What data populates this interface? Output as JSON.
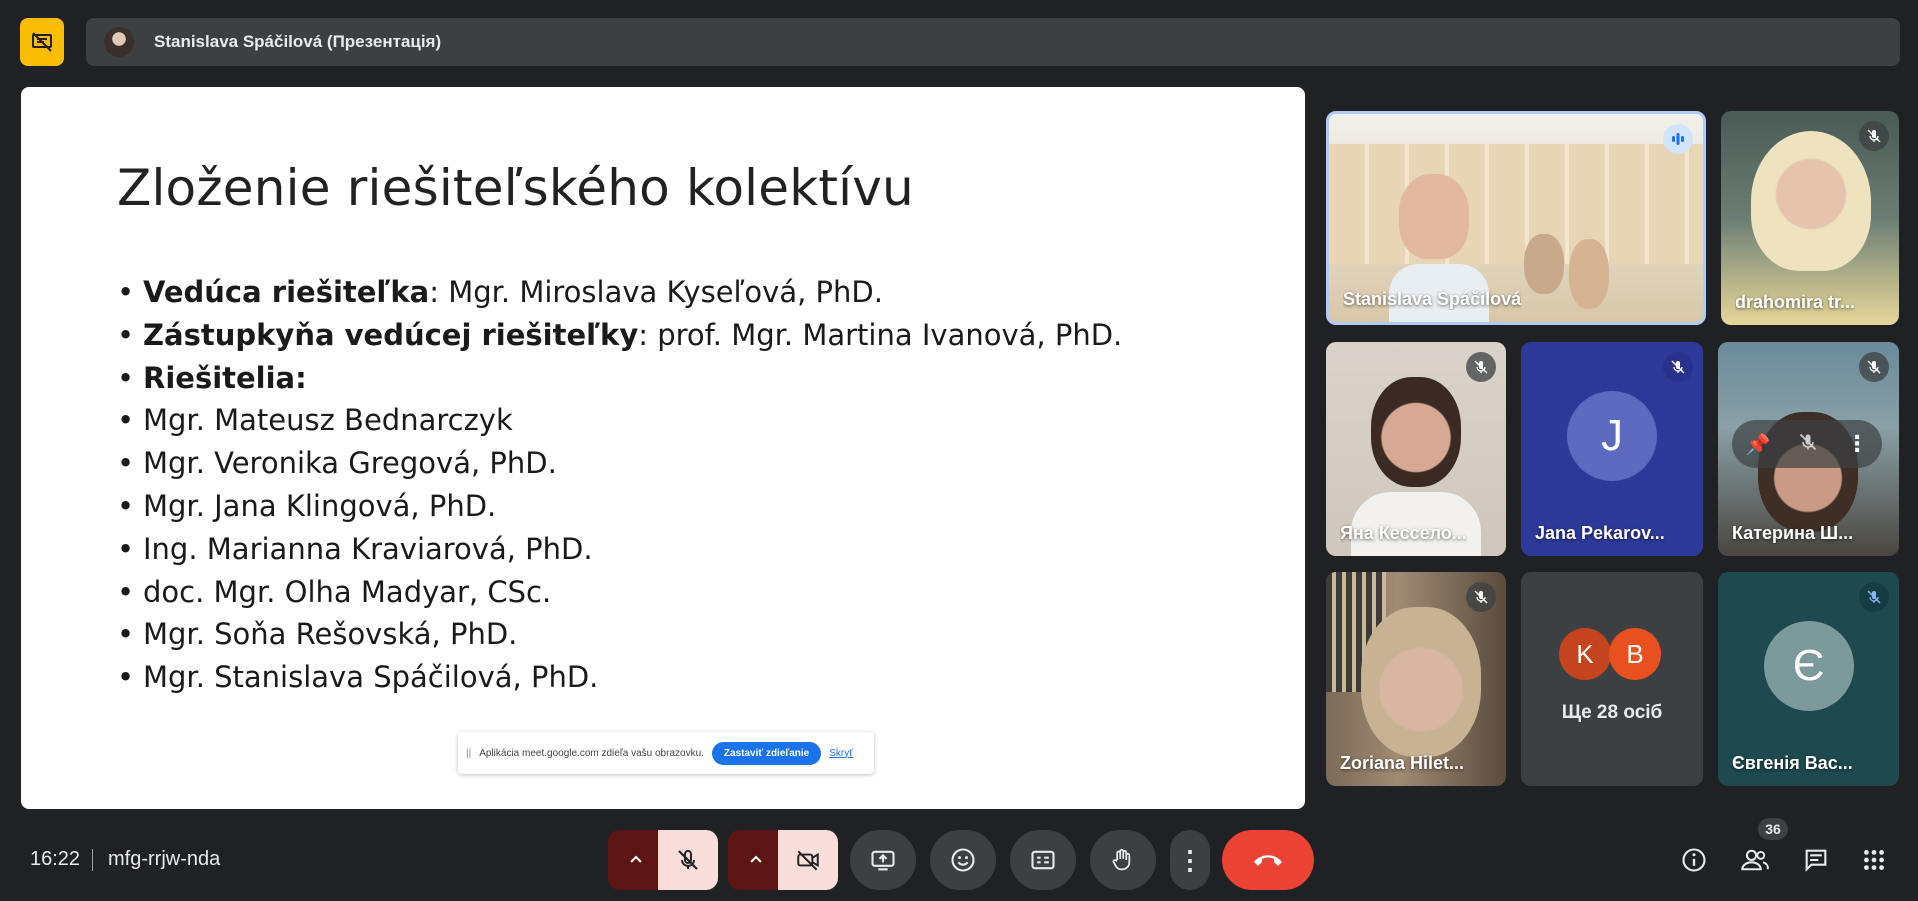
{
  "presenter": {
    "name": "Stanislava Spáčilová (Презентація)"
  },
  "slide": {
    "title": "Zloženie riešiteľského kolektívu",
    "items": [
      {
        "bold": "Vedúca riešiteľka",
        "text": ": Mgr. Miroslava Kyseľová, PhD."
      },
      {
        "bold": "Zástupkyňa vedúcej riešiteľky",
        "text": ": prof. Mgr. Martina Ivanová, PhD."
      },
      {
        "bold": "Riešitelia:",
        "text": ""
      },
      {
        "bold": "",
        "text": "Mgr. Mateusz Bednarczyk"
      },
      {
        "bold": "",
        "text": "Mgr. Veronika Gregová, PhD."
      },
      {
        "bold": "",
        "text": "Mgr. Jana Klingová, PhD."
      },
      {
        "bold": "",
        "text": "Ing. Marianna Kraviarová, PhD."
      },
      {
        "bold": "",
        "text": "doc. Mgr. Olha Madyar, CSc."
      },
      {
        "bold": "",
        "text": "Mgr. Soňa Rešovská, PhD."
      },
      {
        "bold": "",
        "text": "Mgr. Stanislava Spáčilová, PhD."
      }
    ],
    "share_banner": {
      "message": "Aplikácia meet.google.com zdieľa vašu obrazovku.",
      "stop_label": "Zastaviť zdieľanie",
      "hide_label": "Skryť"
    }
  },
  "participants": {
    "p1": "Stanislava Spáčilová",
    "p2": "drahomira tr...",
    "p3": "Яна Кессело...",
    "p4": "Jana Pekarov...",
    "p4_initial": "J",
    "p5": "Катерина Ш...",
    "p6": "Zoriana Hilet...",
    "more_label": "Ще 28 осіб",
    "more_initials": [
      "K",
      "B"
    ],
    "p8": "Євгенія Вас...",
    "p8_initial": "Є"
  },
  "bottom": {
    "time": "16:22",
    "meeting_code": "mfg-rrjw-nda",
    "participant_count": "36"
  },
  "colors": {
    "background": "#202124",
    "accent_yellow": "#fbbc04",
    "end_call": "#ea4335",
    "mic_pill_dark": "#5c1414",
    "mic_pill_light": "#f9dedc"
  }
}
